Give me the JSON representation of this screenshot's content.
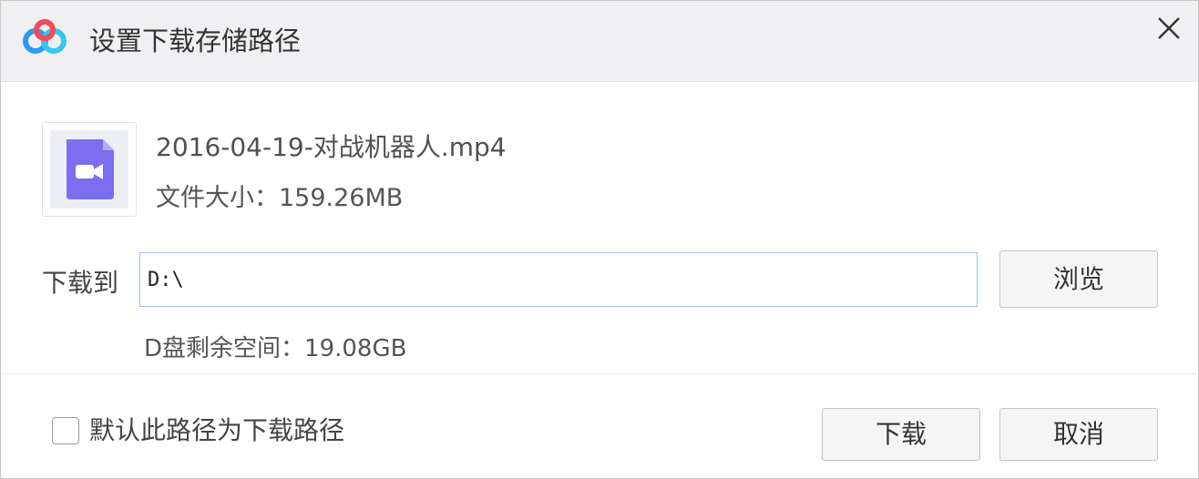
{
  "dialog": {
    "title": "设置下载存储路径",
    "app_icon": "cloud-logo-icon",
    "close_icon": "close-icon"
  },
  "file": {
    "icon": "video-file-icon",
    "name": "2016-04-19-对战机器人.mp4",
    "size_text": "文件大小：159.26MB"
  },
  "destination": {
    "label": "下载到",
    "path_value": "D:\\",
    "browse_label": "浏览",
    "free_space_text": "D盘剩余空间：19.08GB"
  },
  "footer": {
    "default_checkbox_label": "默认此路径为下载路径",
    "default_checked": false,
    "download_label": "下载",
    "cancel_label": "取消"
  },
  "colors": {
    "titlebar_bg": "#f0f0f3",
    "video_icon": "#7b6ff0",
    "input_border": "#9ec1e6"
  }
}
